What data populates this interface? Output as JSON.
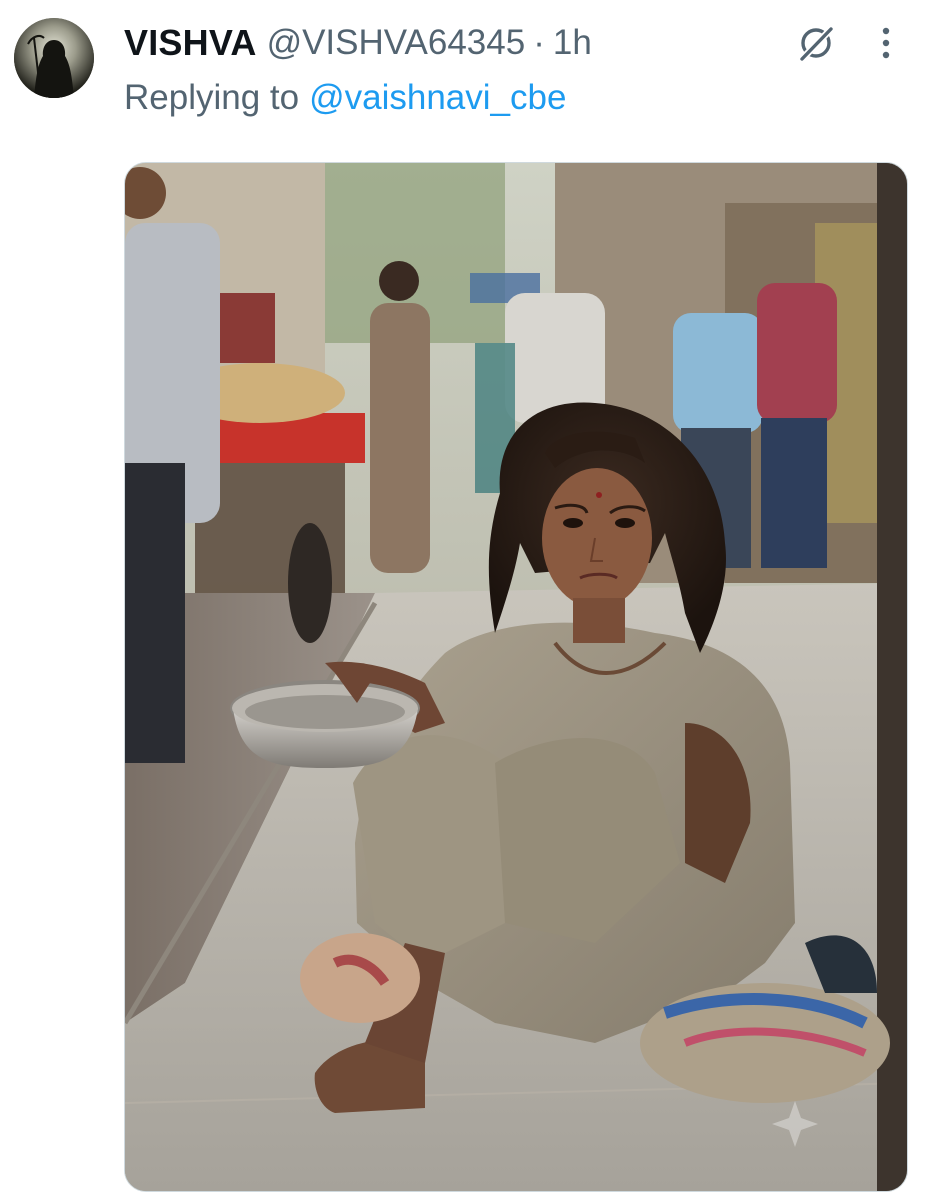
{
  "tweet": {
    "author": {
      "display_name": "VISHVA",
      "handle": "@VISHVA64345",
      "avatar_icon": "hooded-figure-avatar"
    },
    "separator": "·",
    "time": "1h",
    "replying_to": {
      "prefix": "Replying to",
      "handle": "@vaishnavi_cbe"
    },
    "actions": {
      "grok_icon": "grok-icon",
      "more_icon": "more-vertical-icon"
    },
    "media": {
      "type": "photo"
    }
  },
  "colors": {
    "text_primary": "#0f1419",
    "text_secondary": "#536471",
    "link": "#1d9bf0"
  }
}
